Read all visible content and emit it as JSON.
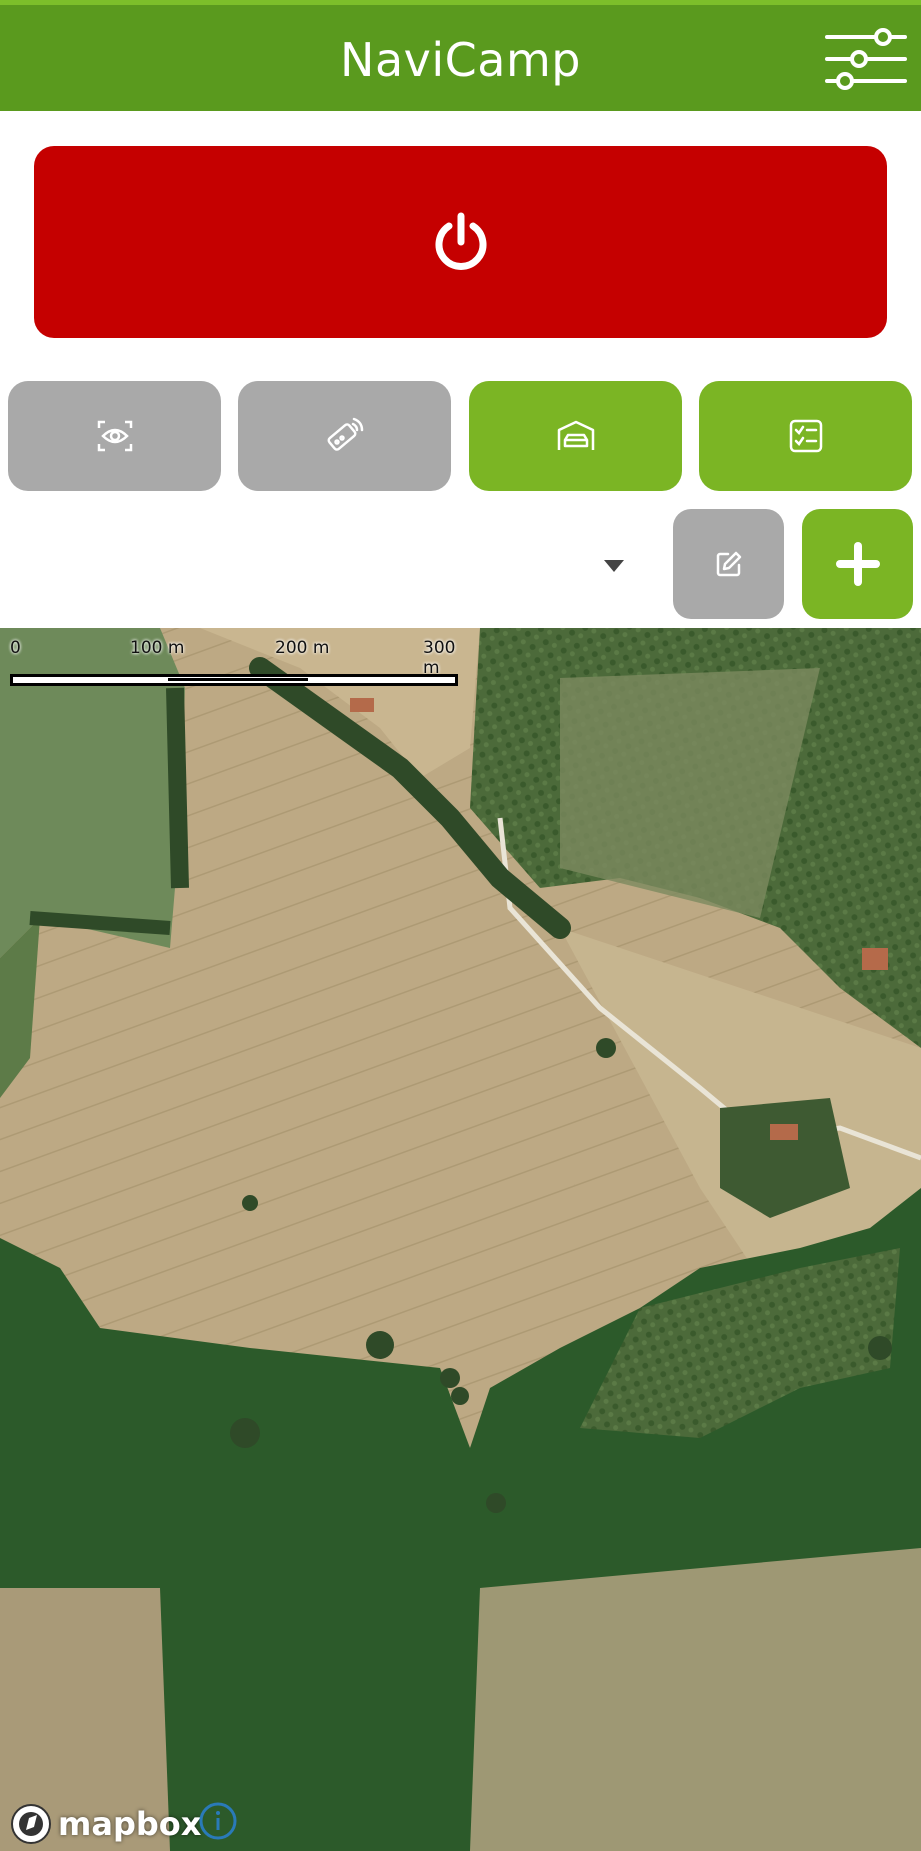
{
  "app": {
    "title": "NaviCamp",
    "header_color": "#5a9a1e"
  },
  "header": {
    "settings_icon": "sliders-icon"
  },
  "power": {
    "icon": "power-icon",
    "color": "#c50000"
  },
  "tiles": [
    {
      "icon": "eye-scan-icon",
      "state": "inactive"
    },
    {
      "icon": "remote-control-icon",
      "state": "inactive"
    },
    {
      "icon": "garage-car-icon",
      "state": "active"
    },
    {
      "icon": "checklist-icon",
      "state": "active"
    }
  ],
  "selector": {
    "value": "",
    "caret_icon": "caret-down-icon"
  },
  "actions": {
    "edit_icon": "edit-icon",
    "add_icon": "plus-icon"
  },
  "map": {
    "scale_labels": [
      "0",
      "100 m",
      "200 m",
      "300 m"
    ],
    "logo_text": "mapbox",
    "info_icon": "info-icon"
  },
  "colors": {
    "active": "#7bb524",
    "inactive": "#a9a9a9"
  }
}
